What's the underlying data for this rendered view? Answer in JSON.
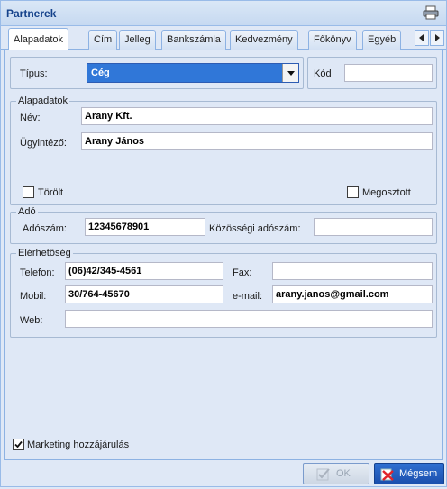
{
  "window": {
    "title": "Partnerek"
  },
  "tabs": [
    "Alapadatok",
    "Cím",
    "Jelleg",
    "Bankszámla",
    "Kedvezmény",
    "Főkönyv",
    "Egyéb"
  ],
  "tipus": {
    "label": "Típus:",
    "value": "Cég"
  },
  "kod": {
    "label": "Kód",
    "value": ""
  },
  "alapadatok": {
    "legend": "Alapadatok",
    "nev_label": "Név:",
    "nev_value": "Arany Kft.",
    "ugyintezo_label": "Ügyintéző:",
    "ugyintezo_value": "Arany János",
    "torolt_label": "Törölt",
    "torolt_checked": false,
    "megosztott_label": "Megosztott",
    "megosztott_checked": false
  },
  "ado": {
    "legend": "Adó",
    "adoszam_label": "Adószám:",
    "adoszam_value": "12345678901",
    "kozossegi_label": "Közösségi adószám:",
    "kozossegi_value": ""
  },
  "elerhetoseg": {
    "legend": "Elérhetőség",
    "telefon_label": "Telefon:",
    "telefon_value": "(06)42/345-4561",
    "fax_label": "Fax:",
    "fax_value": "",
    "mobil_label": "Mobil:",
    "mobil_value": "30/764-45670",
    "email_label": "e-mail:",
    "email_value": "arany.janos@gmail.com",
    "web_label": "Web:",
    "web_value": ""
  },
  "marketing": {
    "label": "Marketing hozzájárulás",
    "checked": true
  },
  "buttons": {
    "ok_label": "OK",
    "cancel_label": "Mégsem"
  },
  "colors": {
    "accent": "#3077d8",
    "cancel_bg": "#1b4fae",
    "title": "#15428b"
  }
}
